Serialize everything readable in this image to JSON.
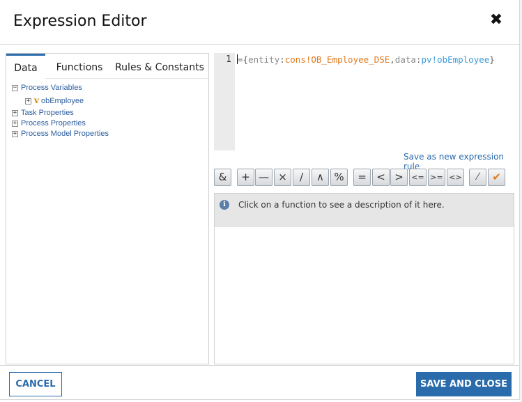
{
  "dialog": {
    "title": "Expression Editor",
    "close_icon": "close-icon"
  },
  "tabs": [
    {
      "label": "Data",
      "active": true
    },
    {
      "label": "Functions",
      "active": false
    },
    {
      "label": "Rules & Constants",
      "active": false
    }
  ],
  "tree": {
    "process_variables": {
      "label": "Process Variables",
      "toggle": "−"
    },
    "ob_employee": {
      "label": "obEmployee",
      "toggle": "+",
      "icon": "v"
    },
    "task_properties": {
      "label": "Task Properties",
      "toggle": "+"
    },
    "process_properties": {
      "label": "Process Properties",
      "toggle": "+"
    },
    "process_model_properties": {
      "label": "Process Model Properties",
      "toggle": "+"
    }
  },
  "editor": {
    "line_number": "1",
    "tokens": {
      "t1": "={",
      "t2": "entity",
      "t3": ":",
      "t4": "cons!OB_Employee_DSE",
      "t5": ",",
      "t6": "data",
      "t7": ":",
      "t8": "pv!obEmployee",
      "t9": "}"
    }
  },
  "save_rule_link": "Save as new expression rule",
  "operators": [
    "&",
    "+",
    "—",
    "×",
    "/",
    "∧",
    "%",
    "=",
    "<",
    ">",
    "<=",
    ">=",
    "<>",
    "wand",
    "check"
  ],
  "description": {
    "text": "Click on a function to see a description of it here.",
    "info_icon": "i"
  },
  "footer": {
    "cancel_label": "CANCEL",
    "save_close_label": "SAVE AND CLOSE"
  },
  "colors": {
    "accent": "#2a6bab",
    "orange_token": "#e07a1f",
    "blue_token": "#3a9ad9"
  }
}
